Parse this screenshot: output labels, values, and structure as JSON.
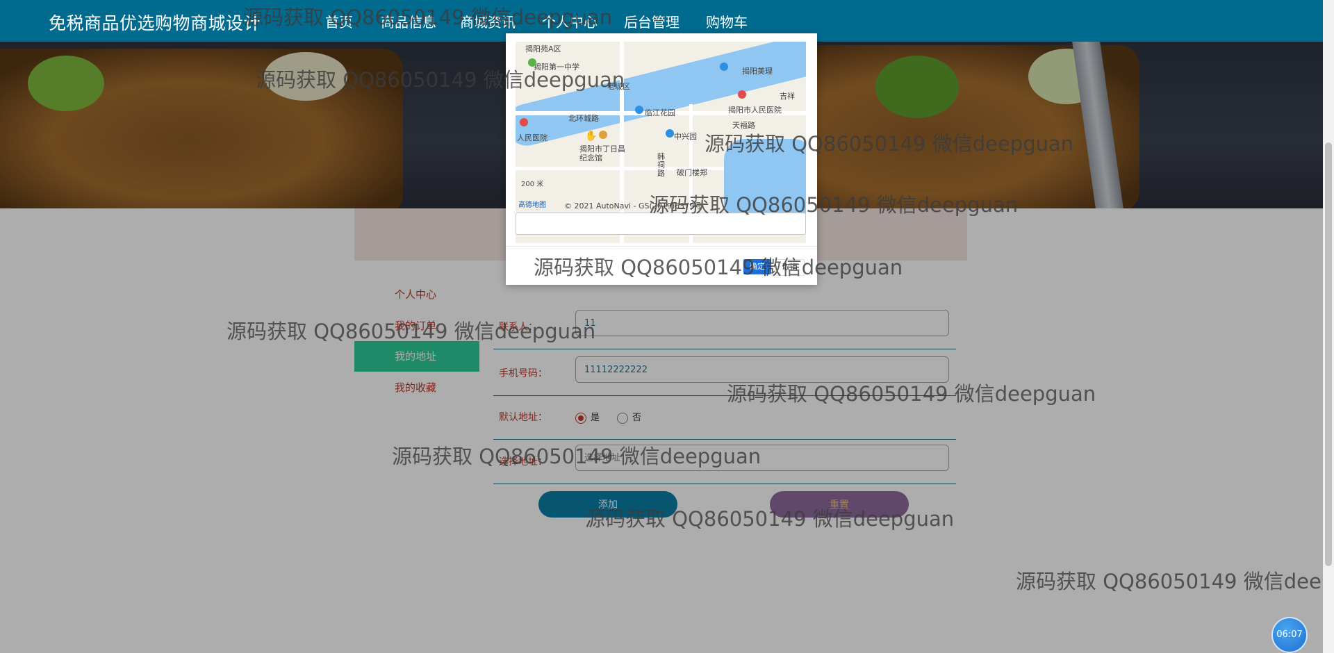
{
  "navbar": {
    "brand": "免税商品优选购物商城设计",
    "items": [
      {
        "label": "首页"
      },
      {
        "label": "商品信息"
      },
      {
        "label": "商城资讯"
      },
      {
        "label": "个人中心"
      },
      {
        "label": "后台管理"
      },
      {
        "label": "购物车"
      }
    ],
    "active_item": "个人中心"
  },
  "sidebar": {
    "items": [
      {
        "label": "个人中心"
      },
      {
        "label": "我的订单"
      },
      {
        "label": "我的地址"
      },
      {
        "label": "我的收藏"
      }
    ],
    "active_item": "我的地址"
  },
  "form": {
    "contact_label": "联系人：",
    "contact_value": "11",
    "phone_label": "手机号码：",
    "phone_value": "11112222222",
    "default_label": "默认地址：",
    "default_options": [
      "是",
      "否"
    ],
    "default_selected": "是",
    "address_label": "选择地址：",
    "address_placeholder": "选择地址",
    "add_label": "添加",
    "reset_label": "重置"
  },
  "map_modal": {
    "attribution": "© 2021 AutoNavi - GS(2019)6379号",
    "scale": "200 米",
    "logo": "高德地图",
    "place_labels": [
      "揭阳第一中学",
      "揭阳市人民医院",
      "临江花园",
      "中兴园",
      "揭阳市丁日昌纪念馆",
      "北环城路",
      "人民医院",
      "韩祠路",
      "破门楼郑",
      "揭阳美理",
      "天福路",
      "吉祥",
      "揭阳苑A区",
      "老城区"
    ],
    "ok_label": "确定",
    "cancel_label": "取消"
  },
  "watermark": {
    "text": "源码获取 QQ86050149 微信deepguan"
  },
  "clock": {
    "time": "06:07"
  },
  "colors": {
    "navbar": "#006b8f",
    "accent_green": "#2ecc9a",
    "label_red": "#c0392b",
    "add_button": "#0a7fa8",
    "reset_button": "#8e6b9e",
    "ok_button": "#1e6fd9"
  }
}
